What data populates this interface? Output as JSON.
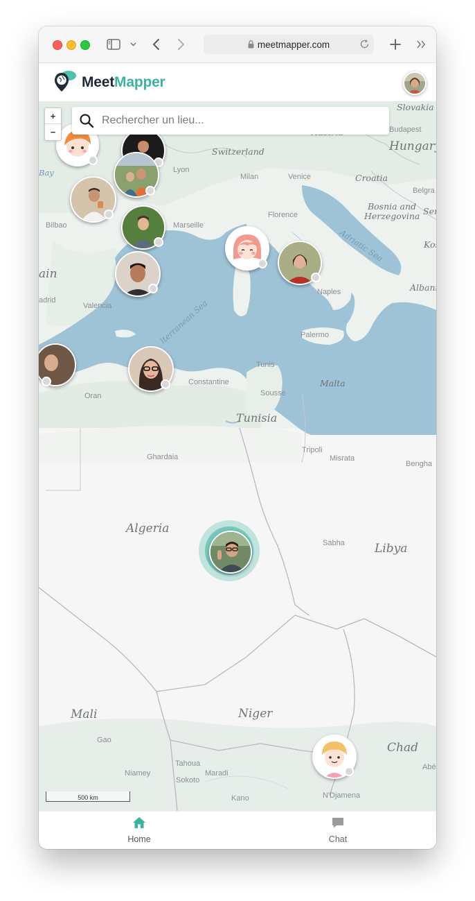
{
  "browser": {
    "url": "meetmapper.com"
  },
  "app": {
    "brand_part1": "Meet",
    "brand_part2": "Mapper",
    "accent": "#3bb3a0"
  },
  "search": {
    "placeholder": "Rechercher un lieu..."
  },
  "map": {
    "zoom_in": "+",
    "zoom_out": "−",
    "scale_label": "500 km",
    "countries": {
      "slovakia": "Slovakia",
      "hungary": "Hungary",
      "austria": "Austria",
      "switzerland": "Switzerland",
      "croatia": "Croatia",
      "bosnia": "Bosnia and Herzegovina",
      "serbia": "Ser",
      "kosovo": "Kos",
      "albania": "Albania",
      "spain": "ain",
      "malta": "Malta",
      "tunisia": "Tunisia",
      "algeria": "Algeria",
      "libya": "Libya",
      "mali": "Mali",
      "niger": "Niger",
      "chad": "Chad"
    },
    "seas": {
      "adriatic": "Adriatic Sea",
      "mediterranean": "lterranean Sea",
      "bay": "Bay"
    },
    "cities": {
      "budapest": "Budapest",
      "lyon": "Lyon",
      "milan": "Milan",
      "venice": "Venice",
      "belgrade": "Belgra",
      "bilbao": "Bilbao",
      "marseille": "Marseille",
      "florence": "Florence",
      "madrid": "adrid",
      "valencia": "Valencia",
      "naples": "Naples",
      "palermo": "Palermo",
      "constantine": "Constantine",
      "tunis": "Tunis",
      "sousse": "Sousse",
      "oran": "Oran",
      "tripoli": "Tripoli",
      "misrata": "Misrata",
      "benghazi": "Bengha",
      "ghardaia": "Ghardaia",
      "sabha": "Sabha",
      "gao": "Gao",
      "tahoua": "Tahoua",
      "niamey": "Niamey",
      "maradi": "Maradi",
      "sokoto": "Sokoto",
      "kano": "Kano",
      "ndjamena": "N'Djamena",
      "abeche": "Abé"
    }
  },
  "nav": {
    "home": "Home",
    "chat": "Chat"
  }
}
